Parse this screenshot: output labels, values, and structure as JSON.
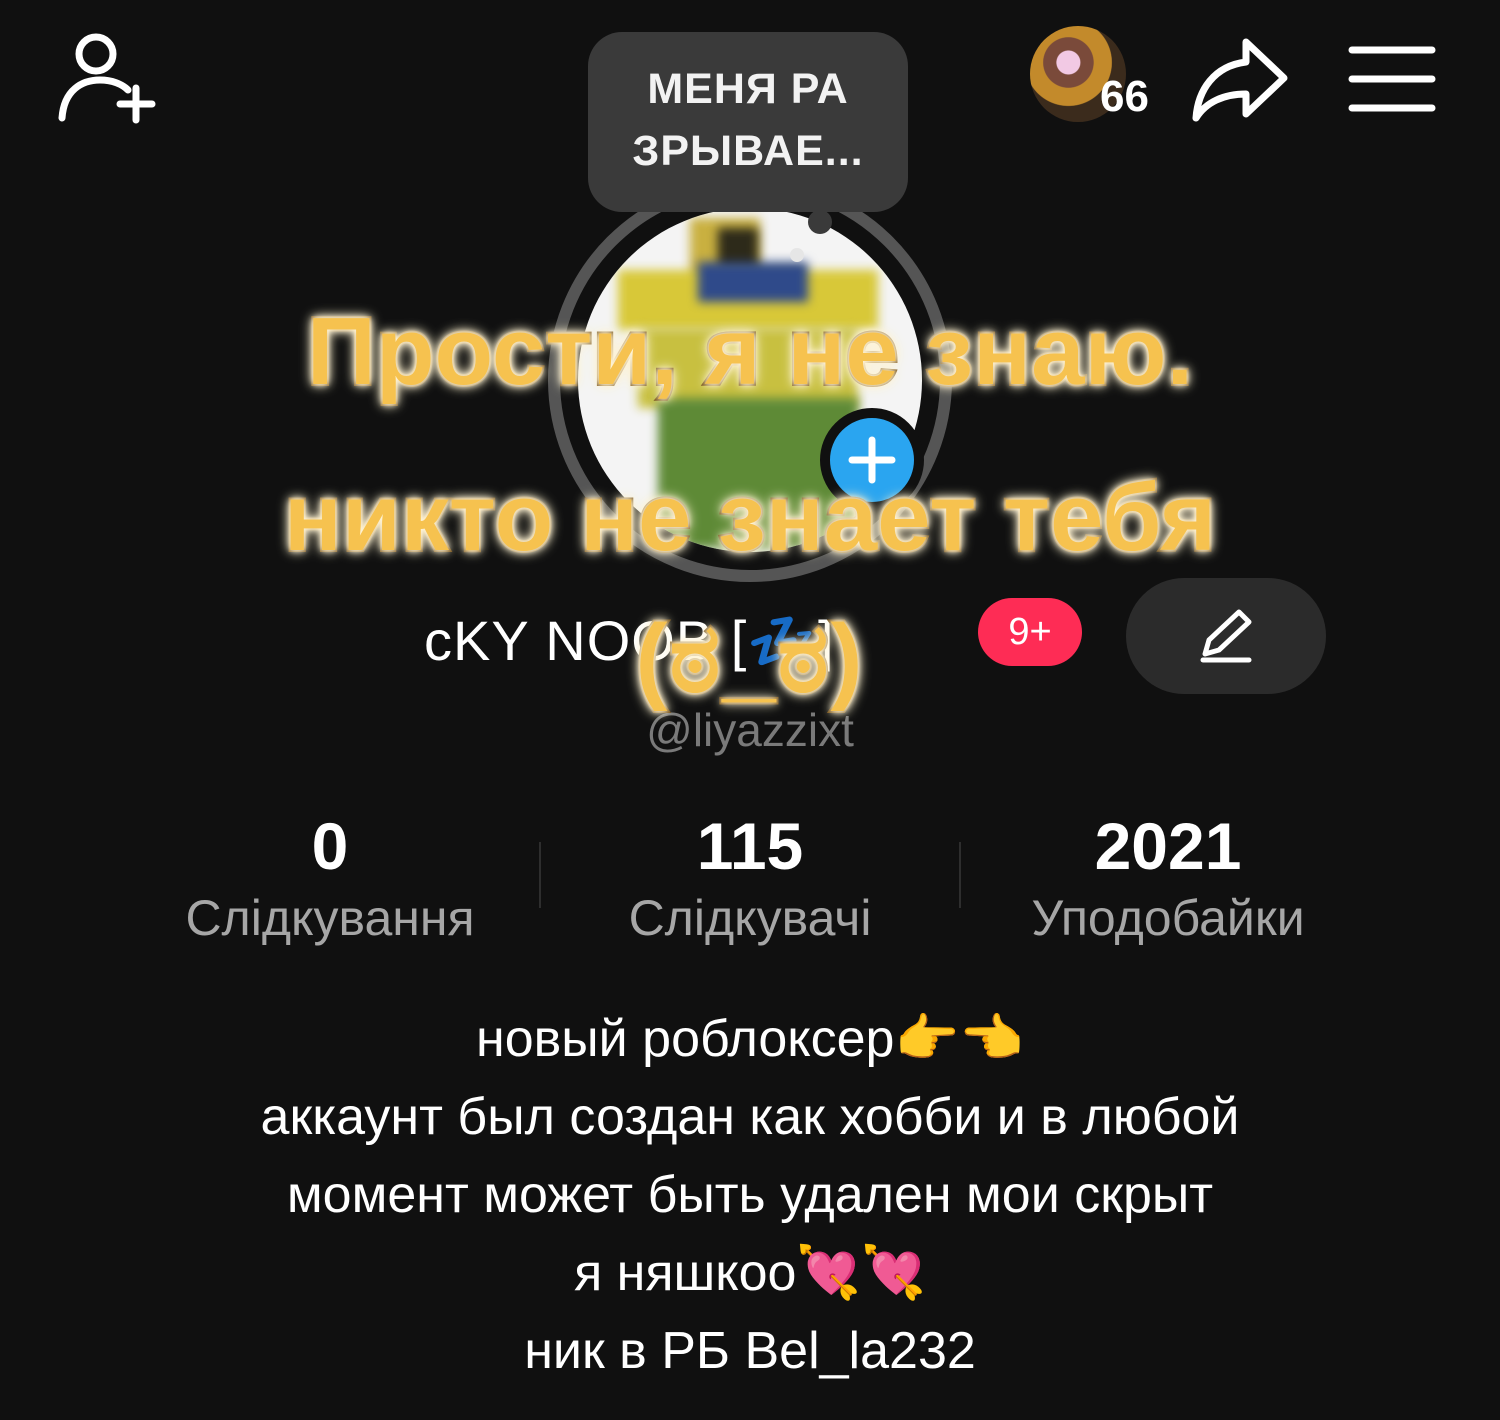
{
  "header": {
    "views_count": "66"
  },
  "bubble": {
    "line1": "МЕНЯ РА",
    "line2": "ЗРЫВАЕ..."
  },
  "caption": {
    "line1": "Прости, я не знаю.",
    "line2": "никто не знает тебя",
    "line3": "(ಠ_ಠ)"
  },
  "profile": {
    "name": "cKY NOOB [💤]",
    "notification_badge": "9+",
    "username": "@liyazzixt"
  },
  "stats": [
    {
      "value": "0",
      "label": "Слідкування"
    },
    {
      "value": "115",
      "label": "Слідкувачі"
    },
    {
      "value": "2021",
      "label": "Уподобайки"
    }
  ],
  "bio": {
    "line1": "новый роблоксер👉👈",
    "line2": "аккаунт был создан как хобби и в любой",
    "line3": "момент может быть удален мои скрыт",
    "line4": "я няшкоо💘💘",
    "line5": "ник в РБ Bel_la232"
  },
  "colors": {
    "background": "#101010",
    "badge": "#fe2c55",
    "add_button": "#2aa5f0",
    "caption_fill": "#f6c24f"
  },
  "icons": [
    "add-friend-icon",
    "share-icon",
    "menu-icon",
    "plus-icon",
    "pencil-icon"
  ]
}
